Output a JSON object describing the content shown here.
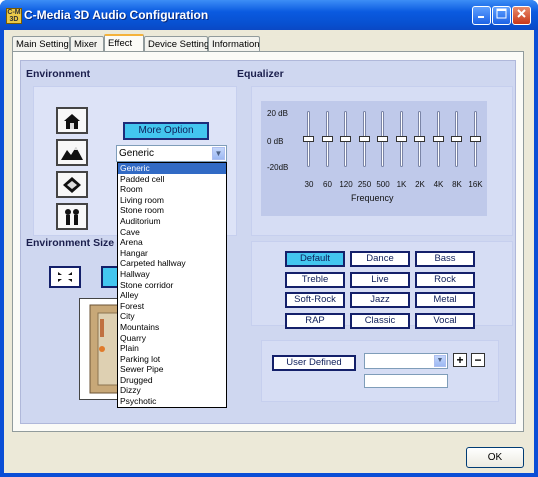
{
  "window": {
    "title": "C-Media 3D Audio Configuration",
    "icon_text": "C-M 3D"
  },
  "tabs": [
    {
      "label": "Main Setting"
    },
    {
      "label": "Mixer"
    },
    {
      "label": "Effect"
    },
    {
      "label": "Device Setting"
    },
    {
      "label": "Information"
    }
  ],
  "active_tab": "Effect",
  "environment": {
    "title": "Environment",
    "more_option_label": "More Option",
    "selected": "Generic",
    "options": [
      "Generic",
      "Padded cell",
      "Room",
      "Living room",
      "Stone room",
      "Auditorium",
      "Cave",
      "Arena",
      "Hangar",
      "Carpeted hallway",
      "Hallway",
      "Stone corridor",
      "Alley",
      "Forest",
      "City",
      "Mountains",
      "Quarry",
      "Plain",
      "Parking lot",
      "Sewer Pipe",
      "Drugged",
      "Dizzy",
      "Psychotic"
    ],
    "icons": [
      "house-icon",
      "mountain-icon",
      "ornament-icon",
      "people-icon"
    ]
  },
  "environment_size": {
    "title": "Environment Size"
  },
  "equalizer": {
    "title": "Equalizer",
    "db_labels": [
      "20 dB",
      "0 dB",
      "-20dB"
    ],
    "bands": [
      "30",
      "60",
      "120",
      "250",
      "500",
      "1K",
      "2K",
      "4K",
      "8K",
      "16K"
    ],
    "band_values_db": [
      0,
      0,
      0,
      0,
      0,
      0,
      0,
      0,
      0,
      0
    ],
    "frequency_label": "Frequency",
    "presets": [
      "Default",
      "Dance",
      "Bass",
      "Treble",
      "Live",
      "Rock",
      "Soft-Rock",
      "Jazz",
      "Metal",
      "RAP",
      "Classic",
      "Vocal"
    ],
    "active_preset": "Default",
    "user_defined_label": "User  Defined"
  },
  "ok_label": "OK",
  "colors": {
    "title_bar": "#0a5ae0",
    "active_button": "#43c6ef",
    "panel": "#cfd7f0"
  }
}
